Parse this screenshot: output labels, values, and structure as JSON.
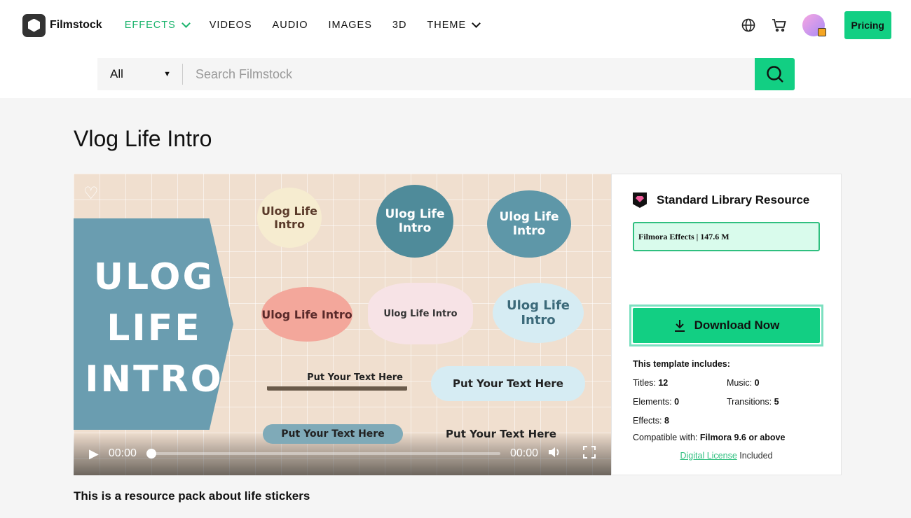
{
  "header": {
    "brand": "Filmstock",
    "nav": [
      {
        "label": "EFFECTS",
        "active": true,
        "dropdown": true
      },
      {
        "label": "VIDEOS"
      },
      {
        "label": "AUDIO"
      },
      {
        "label": "IMAGES"
      },
      {
        "label": "3D"
      },
      {
        "label": "THEME",
        "dropdown": true
      }
    ],
    "pricing": "Pricing"
  },
  "search": {
    "category": "All",
    "placeholder": "Search Filmstock"
  },
  "page": {
    "title": "Vlog Life Intro",
    "description": "This is a resource pack about life stickers"
  },
  "preview": {
    "banner": "ULOG LIFE INTRO",
    "stickers": [
      "Ulog Life Intro",
      "Ulog Life Intro",
      "Ulog Life Intro",
      "Ulog Life Intro",
      "Ulog Life Intro",
      "Ulog Life Intro",
      "Put Your Text Here",
      "Put Your Text Here",
      "Put Your Text Here",
      "Put Your Text Here"
    ],
    "time_current": "00:00",
    "time_total": "00:00",
    "progress": 0
  },
  "panel": {
    "title": "Standard Library Resource",
    "info": "Filmora Effects | 147.6 M",
    "download": "Download Now",
    "includes_label": "This template includes:",
    "stats": [
      {
        "label": "Titles: ",
        "value": "12"
      },
      {
        "label": "Music: ",
        "value": "0"
      },
      {
        "label": "Elements: ",
        "value": "0"
      },
      {
        "label": "Transitions: ",
        "value": "5"
      },
      {
        "label": "Effects: ",
        "value": "8"
      }
    ],
    "compat_label": "Compatible with: ",
    "compat_value": "Filmora 9.6 or above",
    "license_link": "Digital License",
    "license_suffix": " Included"
  },
  "colors": {
    "accent": "#12cf83",
    "banner": "#6a9db0"
  }
}
